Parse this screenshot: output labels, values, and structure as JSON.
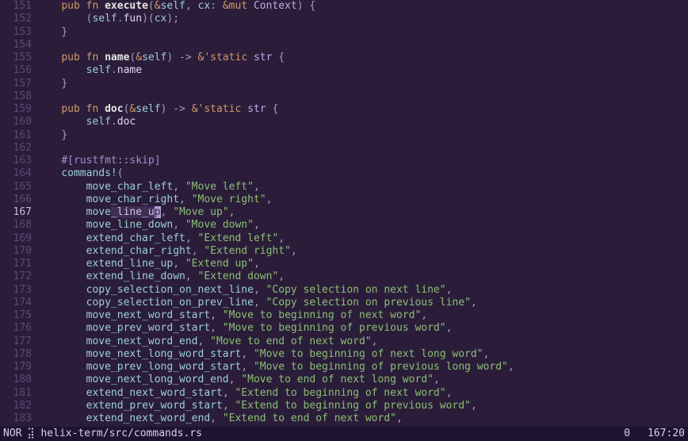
{
  "statusbar": {
    "mode": "NOR",
    "spinner": "⣽",
    "file": "helix-term/src/commands.rs",
    "diagnostics": "0",
    "position": "167:20"
  },
  "gutter": {
    "start": 151,
    "end": 183,
    "current": 167
  },
  "lines": {
    "l151": {
      "ind": "    ",
      "t": [
        [
          "kw",
          "pub"
        ],
        [
          "plain",
          " "
        ],
        [
          "kw",
          "fn"
        ],
        [
          "plain",
          " "
        ],
        [
          "fn",
          "execute"
        ],
        [
          "op",
          "("
        ],
        [
          "amp",
          "&"
        ],
        [
          "slf",
          "self"
        ],
        [
          "op",
          ", "
        ],
        [
          "ident",
          "cx"
        ],
        [
          "op",
          ": "
        ],
        [
          "amp",
          "&"
        ],
        [
          "kw",
          "mut"
        ],
        [
          "plain",
          " "
        ],
        [
          "ty",
          "Context"
        ],
        [
          "op",
          ") {"
        ]
      ]
    },
    "l152": {
      "ind": "        ",
      "t": [
        [
          "op",
          "("
        ],
        [
          "slf",
          "self"
        ],
        [
          "op",
          "."
        ],
        [
          "field",
          "fun"
        ],
        [
          "op",
          ")("
        ],
        [
          "ident",
          "cx"
        ],
        [
          "op",
          ");"
        ]
      ]
    },
    "l153": {
      "ind": "    ",
      "t": [
        [
          "op",
          "}"
        ]
      ]
    },
    "l154": {
      "ind": "",
      "t": []
    },
    "l155": {
      "ind": "    ",
      "t": [
        [
          "kw",
          "pub"
        ],
        [
          "plain",
          " "
        ],
        [
          "kw",
          "fn"
        ],
        [
          "plain",
          " "
        ],
        [
          "fn",
          "name"
        ],
        [
          "op",
          "("
        ],
        [
          "amp",
          "&"
        ],
        [
          "slf",
          "self"
        ],
        [
          "op",
          ") -> "
        ],
        [
          "amp",
          "&"
        ],
        [
          "lt",
          "'static"
        ],
        [
          "plain",
          " "
        ],
        [
          "ty",
          "str"
        ],
        [
          "op",
          " {"
        ]
      ]
    },
    "l156": {
      "ind": "        ",
      "t": [
        [
          "slf",
          "self"
        ],
        [
          "op",
          "."
        ],
        [
          "field",
          "name"
        ]
      ]
    },
    "l157": {
      "ind": "    ",
      "t": [
        [
          "op",
          "}"
        ]
      ]
    },
    "l158": {
      "ind": "",
      "t": []
    },
    "l159": {
      "ind": "    ",
      "t": [
        [
          "kw",
          "pub"
        ],
        [
          "plain",
          " "
        ],
        [
          "kw",
          "fn"
        ],
        [
          "plain",
          " "
        ],
        [
          "fn",
          "doc"
        ],
        [
          "op",
          "("
        ],
        [
          "amp",
          "&"
        ],
        [
          "slf",
          "self"
        ],
        [
          "op",
          ") -> "
        ],
        [
          "amp",
          "&"
        ],
        [
          "lt",
          "'static"
        ],
        [
          "plain",
          " "
        ],
        [
          "ty",
          "str"
        ],
        [
          "op",
          " {"
        ]
      ]
    },
    "l160": {
      "ind": "        ",
      "t": [
        [
          "slf",
          "self"
        ],
        [
          "op",
          "."
        ],
        [
          "field",
          "doc"
        ]
      ]
    },
    "l161": {
      "ind": "    ",
      "t": [
        [
          "op",
          "}"
        ]
      ]
    },
    "l162": {
      "ind": "",
      "t": []
    },
    "l163": {
      "ind": "    ",
      "t": [
        [
          "attr",
          "#[rustfmt::skip]"
        ]
      ]
    },
    "l164": {
      "ind": "    ",
      "t": [
        [
          "macro",
          "commands!"
        ],
        [
          "op",
          "("
        ]
      ]
    },
    "l165": {
      "ind": "        ",
      "t": [
        [
          "ident",
          "move_char_left"
        ],
        [
          "op",
          ", "
        ],
        [
          "str",
          "\"Move left\""
        ],
        [
          "op",
          ","
        ]
      ]
    },
    "l166": {
      "ind": "        ",
      "t": [
        [
          "ident",
          "move_char_right"
        ],
        [
          "op",
          ", "
        ],
        [
          "str",
          "\"Move right\""
        ],
        [
          "op",
          ","
        ]
      ]
    },
    "l167": {
      "ind": "        ",
      "t": [
        [
          "ident",
          "move"
        ],
        [
          "sel",
          "_line_u"
        ],
        [
          "cursor",
          "p"
        ],
        [
          "op",
          ", "
        ],
        [
          "str",
          "\"Move up\""
        ],
        [
          "op",
          ","
        ]
      ]
    },
    "l168": {
      "ind": "        ",
      "t": [
        [
          "ident",
          "move_line_down"
        ],
        [
          "op",
          ", "
        ],
        [
          "str",
          "\"Move down\""
        ],
        [
          "op",
          ","
        ]
      ]
    },
    "l169": {
      "ind": "        ",
      "t": [
        [
          "ident",
          "extend_char_left"
        ],
        [
          "op",
          ", "
        ],
        [
          "str",
          "\"Extend left\""
        ],
        [
          "op",
          ","
        ]
      ]
    },
    "l170": {
      "ind": "        ",
      "t": [
        [
          "ident",
          "extend_char_right"
        ],
        [
          "op",
          ", "
        ],
        [
          "str",
          "\"Extend right\""
        ],
        [
          "op",
          ","
        ]
      ]
    },
    "l171": {
      "ind": "        ",
      "t": [
        [
          "ident",
          "extend_line_up"
        ],
        [
          "op",
          ", "
        ],
        [
          "str",
          "\"Extend up\""
        ],
        [
          "op",
          ","
        ]
      ]
    },
    "l172": {
      "ind": "        ",
      "t": [
        [
          "ident",
          "extend_line_down"
        ],
        [
          "op",
          ", "
        ],
        [
          "str",
          "\"Extend down\""
        ],
        [
          "op",
          ","
        ]
      ]
    },
    "l173": {
      "ind": "        ",
      "t": [
        [
          "ident",
          "copy_selection_on_next_line"
        ],
        [
          "op",
          ", "
        ],
        [
          "str",
          "\"Copy selection on next line\""
        ],
        [
          "op",
          ","
        ]
      ]
    },
    "l174": {
      "ind": "        ",
      "t": [
        [
          "ident",
          "copy_selection_on_prev_line"
        ],
        [
          "op",
          ", "
        ],
        [
          "str",
          "\"Copy selection on previous line\""
        ],
        [
          "op",
          ","
        ]
      ]
    },
    "l175": {
      "ind": "        ",
      "t": [
        [
          "ident",
          "move_next_word_start"
        ],
        [
          "op",
          ", "
        ],
        [
          "str",
          "\"Move to beginning of next word\""
        ],
        [
          "op",
          ","
        ]
      ]
    },
    "l176": {
      "ind": "        ",
      "t": [
        [
          "ident",
          "move_prev_word_start"
        ],
        [
          "op",
          ", "
        ],
        [
          "str",
          "\"Move to beginning of previous word\""
        ],
        [
          "op",
          ","
        ]
      ]
    },
    "l177": {
      "ind": "        ",
      "t": [
        [
          "ident",
          "move_next_word_end"
        ],
        [
          "op",
          ", "
        ],
        [
          "str",
          "\"Move to end of next word\""
        ],
        [
          "op",
          ","
        ]
      ]
    },
    "l178": {
      "ind": "        ",
      "t": [
        [
          "ident",
          "move_next_long_word_start"
        ],
        [
          "op",
          ", "
        ],
        [
          "str",
          "\"Move to beginning of next long word\""
        ],
        [
          "op",
          ","
        ]
      ]
    },
    "l179": {
      "ind": "        ",
      "t": [
        [
          "ident",
          "move_prev_long_word_start"
        ],
        [
          "op",
          ", "
        ],
        [
          "str",
          "\"Move to beginning of previous long word\""
        ],
        [
          "op",
          ","
        ]
      ]
    },
    "l180": {
      "ind": "        ",
      "t": [
        [
          "ident",
          "move_next_long_word_end"
        ],
        [
          "op",
          ", "
        ],
        [
          "str",
          "\"Move to end of next long word\""
        ],
        [
          "op",
          ","
        ]
      ]
    },
    "l181": {
      "ind": "        ",
      "t": [
        [
          "ident",
          "extend_next_word_start"
        ],
        [
          "op",
          ", "
        ],
        [
          "str",
          "\"Extend to beginning of next word\""
        ],
        [
          "op",
          ","
        ]
      ]
    },
    "l182": {
      "ind": "        ",
      "t": [
        [
          "ident",
          "extend_prev_word_start"
        ],
        [
          "op",
          ", "
        ],
        [
          "str",
          "\"Extend to beginning of previous word\""
        ],
        [
          "op",
          ","
        ]
      ]
    },
    "l183": {
      "ind": "        ",
      "t": [
        [
          "ident",
          "extend_next_word_end"
        ],
        [
          "op",
          ", "
        ],
        [
          "str",
          "\"Extend to end of next word\""
        ],
        [
          "op",
          ","
        ]
      ]
    }
  }
}
